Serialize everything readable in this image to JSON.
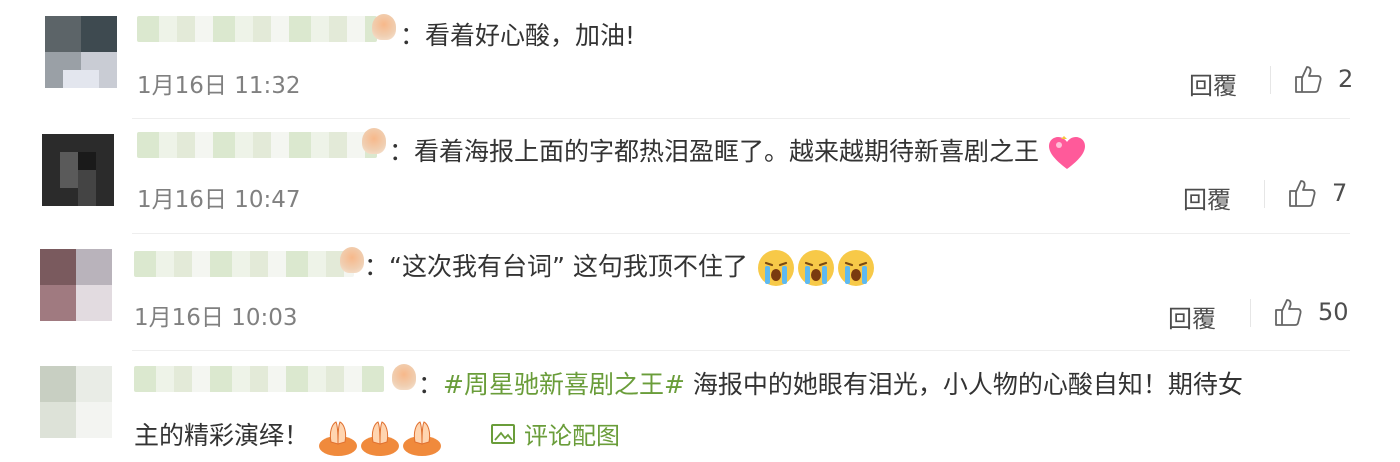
{
  "comments": [
    {
      "text": "：看着好心酸，加油!",
      "time": "1月16日 11:32",
      "reply": "回覆",
      "likes": "2"
    },
    {
      "text": "：看着海报上面的字都热泪盈眶了。越来越期待新喜剧之王",
      "time": "1月16日 10:47",
      "reply": "回覆",
      "likes": "7"
    },
    {
      "text": "：“这次我有台词” 这句我顶不住了",
      "time": "1月16日 10:03",
      "reply": "回覆",
      "likes": "50"
    },
    {
      "text_prefix": "：",
      "topic": "#周星驰新喜剧之王#",
      "text_line1": " 海报中的她眼有泪光，小人物的心酸自知！期待女",
      "text_line2": "主的精彩演绎！",
      "view_pic": "评论配图"
    }
  ],
  "icons": {
    "like": "thumbs-up-icon",
    "image": "image-icon",
    "heart": "heart-emoji",
    "cry": "crying-emoji",
    "pray": "praying-hands-emoji"
  },
  "colors": {
    "topic": "#6a9d3a",
    "time": "#808080",
    "text": "#333333"
  }
}
